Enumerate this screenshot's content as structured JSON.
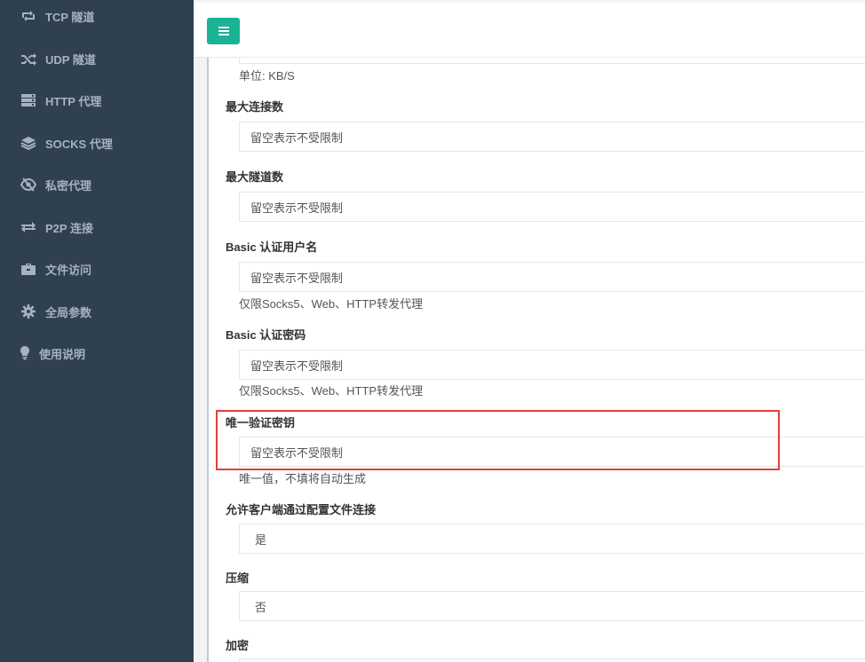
{
  "sidebar": {
    "items": [
      {
        "label": "TCP 隧道",
        "icon": "retweet-icon"
      },
      {
        "label": "UDP 隧道",
        "icon": "random-icon"
      },
      {
        "label": "HTTP 代理",
        "icon": "server-icon"
      },
      {
        "label": "SOCKS 代理",
        "icon": "layers-icon"
      },
      {
        "label": "私密代理",
        "icon": "eye-slash-icon"
      },
      {
        "label": "P2P 连接",
        "icon": "exchange-icon"
      },
      {
        "label": "文件访问",
        "icon": "briefcase-icon"
      },
      {
        "label": "全局参数",
        "icon": "gear-icon"
      },
      {
        "label": "使用说明",
        "icon": "lightbulb-icon"
      }
    ]
  },
  "form": {
    "rate_unit_help": "单位: KB/S",
    "max_conn": {
      "label": "最大连接数",
      "placeholder": "留空表示不受限制"
    },
    "max_tunnel": {
      "label": "最大隧道数",
      "placeholder": "留空表示不受限制"
    },
    "basic_user": {
      "label": "Basic 认证用户名",
      "placeholder": "留空表示不受限制",
      "help": "仅限Socks5、Web、HTTP转发代理"
    },
    "basic_pass": {
      "label": "Basic 认证密码",
      "placeholder": "留空表示不受限制",
      "help": "仅限Socks5、Web、HTTP转发代理"
    },
    "unique_key": {
      "label": "唯一验证密钥",
      "placeholder": "留空表示不受限制",
      "help": "唯一值，不填将自动生成"
    },
    "allow_config": {
      "label": "允许客户端通过配置文件连接",
      "value": "是"
    },
    "compress": {
      "label": "压缩",
      "value": "否"
    },
    "encrypt": {
      "label": "加密"
    }
  },
  "colors": {
    "sidebar_bg": "#2f4050",
    "accent": "#1ab394",
    "highlight": "#e0403a"
  }
}
